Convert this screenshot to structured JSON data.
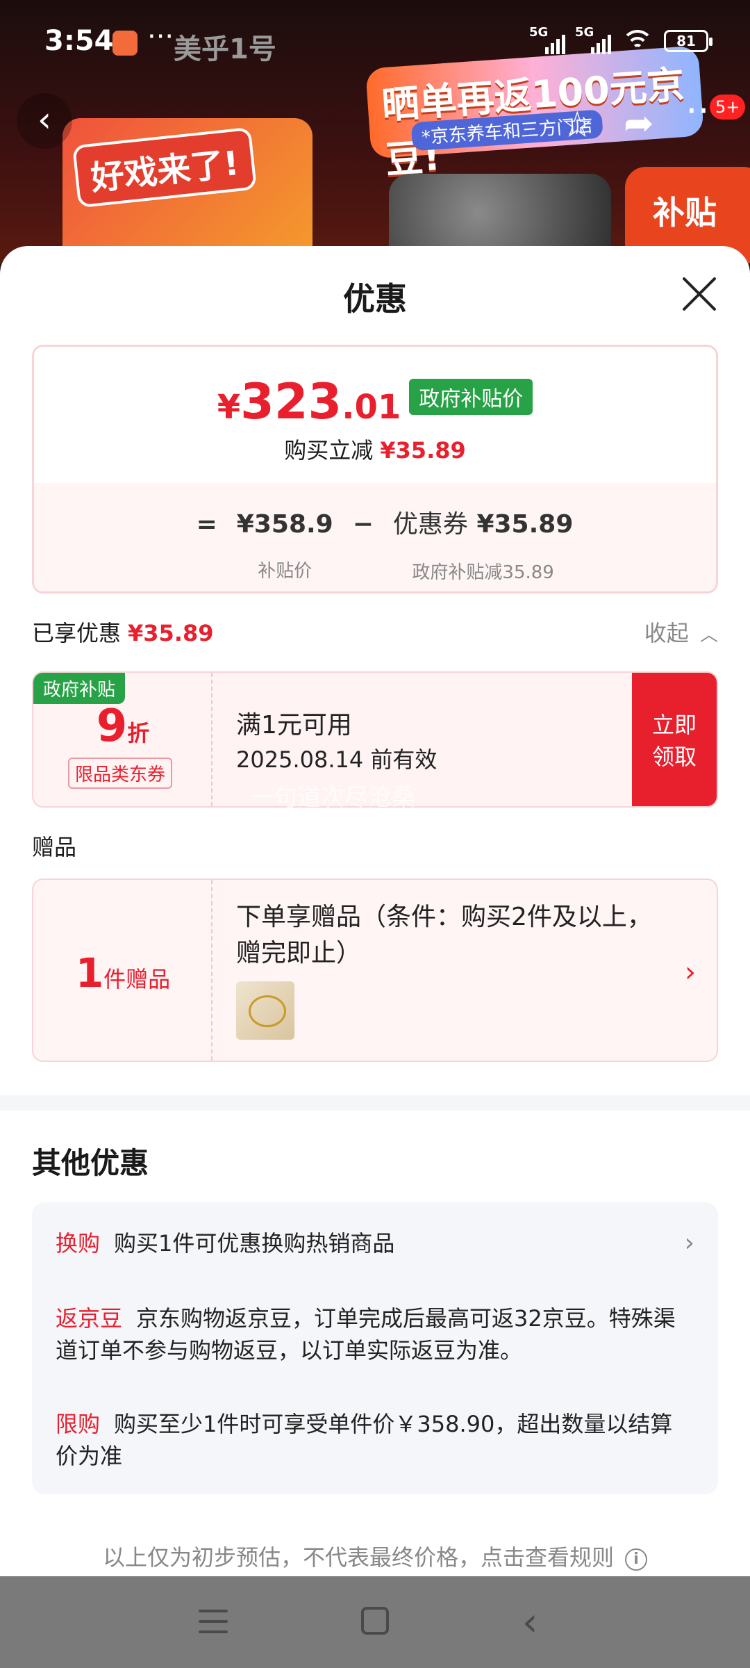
{
  "status_bar": {
    "time": "3:54",
    "dots": "···",
    "carrier": "美乎1号",
    "sim1": "5G",
    "sim2": "5G",
    "battery": "81"
  },
  "background": {
    "promo_bubble": "好戏来了!",
    "promo_banner": "晒单再返100元京豆!",
    "promo_banner_sub": "*京东养车和三方门店",
    "badge": "补贴"
  },
  "nav": {
    "more_badge": "5+"
  },
  "sheet": {
    "title": "优惠",
    "price": {
      "currency": "¥",
      "integer": "323",
      "decimal": ".01",
      "tag": "政府补贴价",
      "reduce_label": "购买立减",
      "reduce_amount": "¥35.89"
    },
    "formula": {
      "equals": "=",
      "base_value": "¥358.9",
      "base_label": "补贴价",
      "minus": "−",
      "coupon_label": "优惠券",
      "coupon_value": "¥35.89",
      "coupon_sub": "政府补贴减35.89"
    },
    "enjoyed": {
      "label": "已享优惠",
      "amount": "¥35.89",
      "collapse": "收起"
    },
    "coupon": {
      "tag": "政府补贴",
      "discount_num": "9",
      "discount_unit": "折",
      "limit": "限品类东券",
      "condition": "满1元可用",
      "valid": "2025.08.14 前有效",
      "claim_line1": "立即",
      "claim_line2": "领取"
    },
    "gift": {
      "section_title": "赠品",
      "count_num": "1",
      "count_unit": "件赠品",
      "desc": "下单享赠品（条件：购买2件及以上，赠完即止）"
    },
    "other": {
      "title": "其他优惠",
      "items": [
        {
          "key": "换购",
          "text": "购买1件可优惠换购热销商品"
        },
        {
          "key": "返京豆",
          "text": "京东购物返京豆，订单完成后最高可返32京豆。特殊渠道订单不参与购物返豆，以订单实际返豆为准。"
        },
        {
          "key": "限购",
          "text": "购买至少1件时可享受单件价￥358.90，超出数量以结算价为准"
        }
      ]
    },
    "footnote": "以上仅为初步预估，不代表最终价格，点击查看规则"
  },
  "watermark": "一句道次尽沧桑",
  "colors": {
    "accent": "#e8202e",
    "gov_green": "#27a246"
  }
}
